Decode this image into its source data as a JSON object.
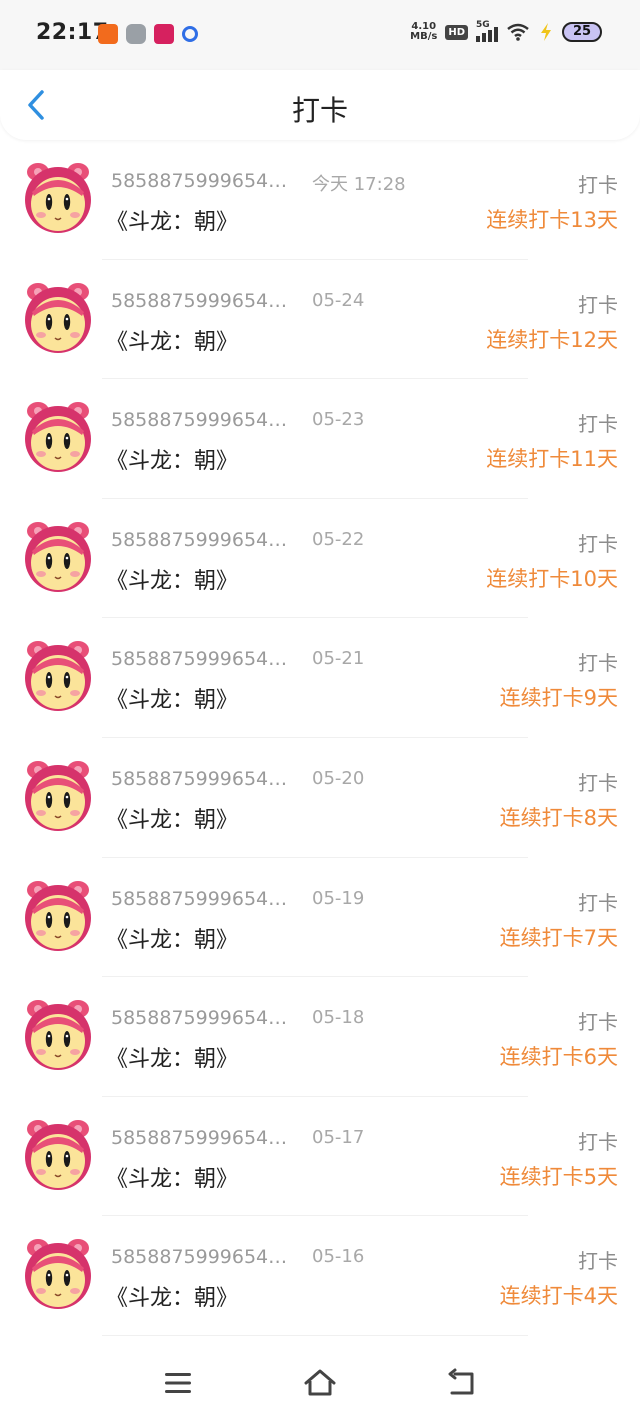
{
  "status_bar": {
    "time": "22:17",
    "apps": [
      "orange-app-icon",
      "grey-app-icon",
      "red-app-icon",
      "baidu-paw-icon"
    ],
    "net_speed_value": "4.10",
    "net_speed_unit": "MB/s",
    "hd_label": "HD",
    "network_label": "5G",
    "battery": "25"
  },
  "header": {
    "title": "打卡"
  },
  "items": [
    {
      "uid": "5858875999654…",
      "date": "今天 17:28",
      "title": "《斗龙：朝》",
      "tag": "打卡",
      "streak": "连续打卡13天"
    },
    {
      "uid": "5858875999654…",
      "date": "05-24",
      "title": "《斗龙：朝》",
      "tag": "打卡",
      "streak": "连续打卡12天"
    },
    {
      "uid": "5858875999654…",
      "date": "05-23",
      "title": "《斗龙：朝》",
      "tag": "打卡",
      "streak": "连续打卡11天"
    },
    {
      "uid": "5858875999654…",
      "date": "05-22",
      "title": "《斗龙：朝》",
      "tag": "打卡",
      "streak": "连续打卡10天"
    },
    {
      "uid": "5858875999654…",
      "date": "05-21",
      "title": "《斗龙：朝》",
      "tag": "打卡",
      "streak": "连续打卡9天"
    },
    {
      "uid": "5858875999654…",
      "date": "05-20",
      "title": "《斗龙：朝》",
      "tag": "打卡",
      "streak": "连续打卡8天"
    },
    {
      "uid": "5858875999654…",
      "date": "05-19",
      "title": "《斗龙：朝》",
      "tag": "打卡",
      "streak": "连续打卡7天"
    },
    {
      "uid": "5858875999654…",
      "date": "05-18",
      "title": "《斗龙：朝》",
      "tag": "打卡",
      "streak": "连续打卡6天"
    },
    {
      "uid": "5858875999654…",
      "date": "05-17",
      "title": "《斗龙：朝》",
      "tag": "打卡",
      "streak": "连续打卡5天"
    },
    {
      "uid": "5858875999654…",
      "date": "05-16",
      "title": "《斗龙：朝》",
      "tag": "打卡",
      "streak": "连续打卡4天"
    }
  ],
  "colors": {
    "accent_blue": "#2f8fe0",
    "streak_orange": "#ef8a3a",
    "muted_text": "#9a9a9a"
  },
  "navbar": {
    "icons": [
      "menu-icon",
      "home-icon",
      "back-icon"
    ]
  }
}
